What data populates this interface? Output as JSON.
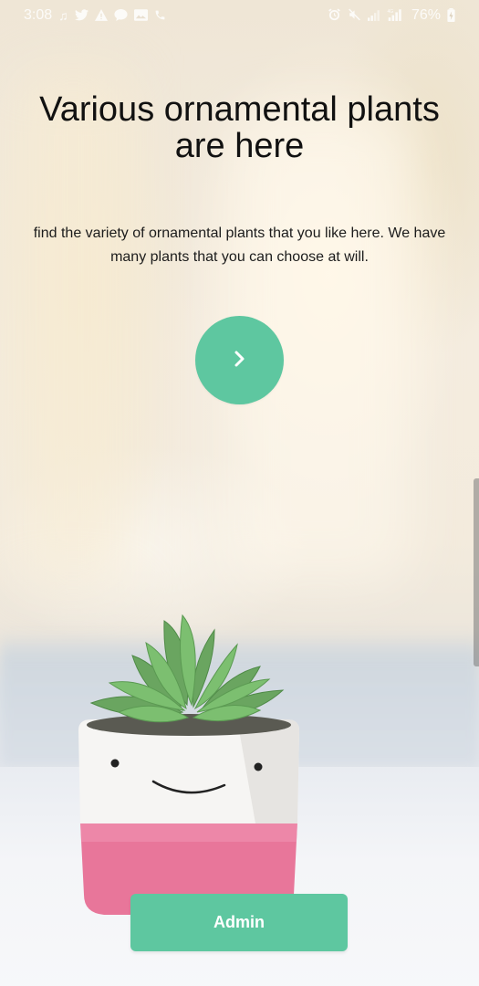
{
  "status_bar": {
    "time": "3:08",
    "battery": "76%",
    "left_icons": [
      "music-icon",
      "twitter-icon",
      "alert-icon",
      "chat-icon",
      "image-icon",
      "phone-icon"
    ],
    "right_icons": [
      "alarm-icon",
      "mute-icon",
      "signal-icon",
      "lte-signal-icon",
      "battery-icon"
    ]
  },
  "onboarding": {
    "headline": "Various ornamental plants are here",
    "subtitle": "find the variety of ornamental plants that you like here. We have many plants that you can choose at will.",
    "next_icon": "chevron-right-icon",
    "admin_label": "Admin"
  },
  "colors": {
    "accent": "#5ec7a0",
    "text_primary": "#111111"
  }
}
